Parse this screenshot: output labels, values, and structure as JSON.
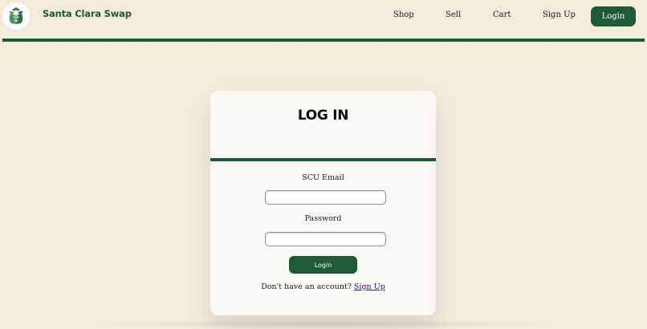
{
  "header": {
    "brand": "Santa Clara Swap",
    "logo_icon": "recycle-logo-icon",
    "nav": {
      "shop": "Shop",
      "sell": "Sell",
      "cart": "Cart",
      "signup": "Sign Up",
      "login": "Login"
    }
  },
  "login_card": {
    "title": "LOG IN",
    "email_label": "SCU Email",
    "email_value": "",
    "password_label": "Password",
    "password_value": "",
    "submit_label": "Login",
    "signup_prompt": "Don't have an account?",
    "signup_link": "Sign Up"
  },
  "colors": {
    "brand_green": "#1f5a36",
    "page_background": "#f3ebdc",
    "card_background": "#f9f8f2",
    "link_blue": "#1a0dab"
  }
}
